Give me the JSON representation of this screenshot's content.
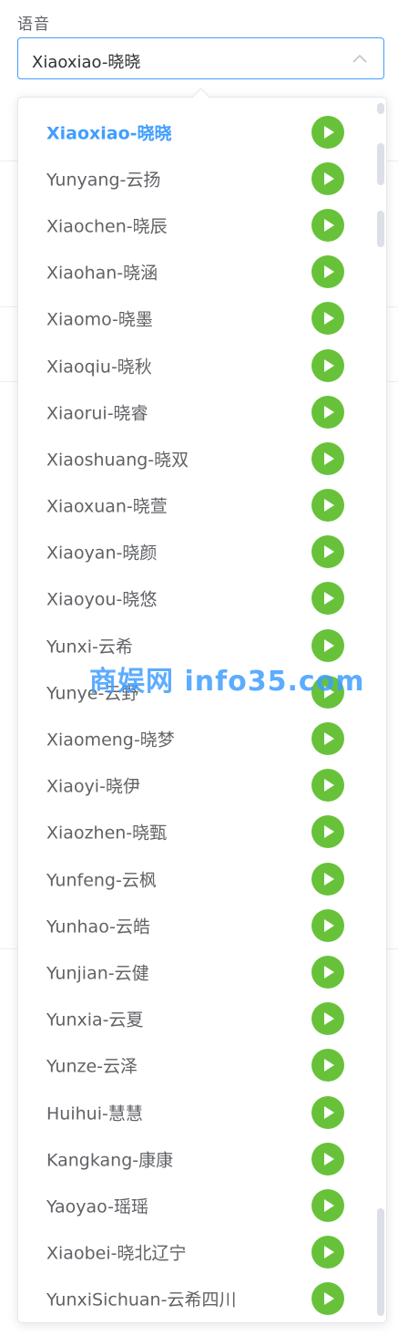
{
  "form": {
    "label": "语音",
    "select_value": "Xiaoxiao-晓晓"
  },
  "dropdown": {
    "selected_index": 0,
    "hovered_index": 26,
    "options": [
      "Xiaoxiao-晓晓",
      "Yunyang-云扬",
      "Xiaochen-晓辰",
      "Xiaohan-晓涵",
      "Xiaomo-晓墨",
      "Xiaoqiu-晓秋",
      "Xiaorui-晓睿",
      "Xiaoshuang-晓双",
      "Xiaoxuan-晓萱",
      "Xiaoyan-晓颜",
      "Xiaoyou-晓悠",
      "Yunxi-云希",
      "Yunye-云野",
      "Xiaomeng-晓梦",
      "Xiaoyi-晓伊",
      "Xiaozhen-晓甄",
      "Yunfeng-云枫",
      "Yunhao-云皓",
      "Yunjian-云健",
      "Yunxia-云夏",
      "Yunze-云泽",
      "Huihui-慧慧",
      "Kangkang-康康",
      "Yaoyao-瑶瑶",
      "Xiaobei-晓北辽宁",
      "YunxiSichuan-云希四川"
    ],
    "play_icon": "play-circle-icon"
  },
  "watermark": "商娱网 info35.com",
  "colors": {
    "accent": "#409eff",
    "play": "#67c23a",
    "text": "#606266",
    "border": "#dcdfe6"
  }
}
